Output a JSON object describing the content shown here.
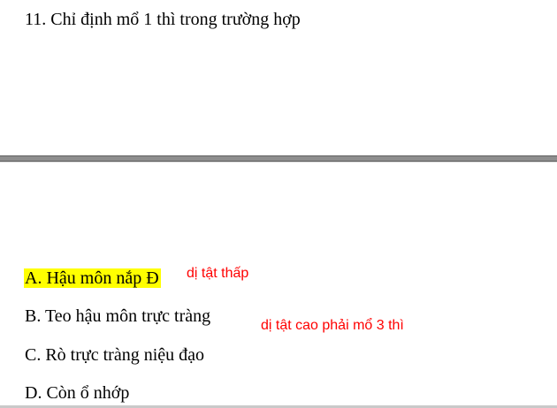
{
  "question": {
    "text": "11. Chỉ định mổ 1 thì trong trường hợp"
  },
  "options": [
    {
      "text": "A. Hậu môn nắp Đ",
      "highlighted": true
    },
    {
      "text": "B. Teo hậu môn trực tràng",
      "highlighted": false
    },
    {
      "text": "C. Rò trực tràng niệu đạo",
      "highlighted": false
    },
    {
      "text": "D. Còn ổ nhớp",
      "highlighted": false
    }
  ],
  "annotations": [
    {
      "text": "dị tật thấp"
    },
    {
      "text": "dị tật cao phải mổ 3 thì"
    }
  ],
  "colors": {
    "highlight": "#ffff00",
    "annotation": "#ff0000",
    "text": "#000000"
  }
}
